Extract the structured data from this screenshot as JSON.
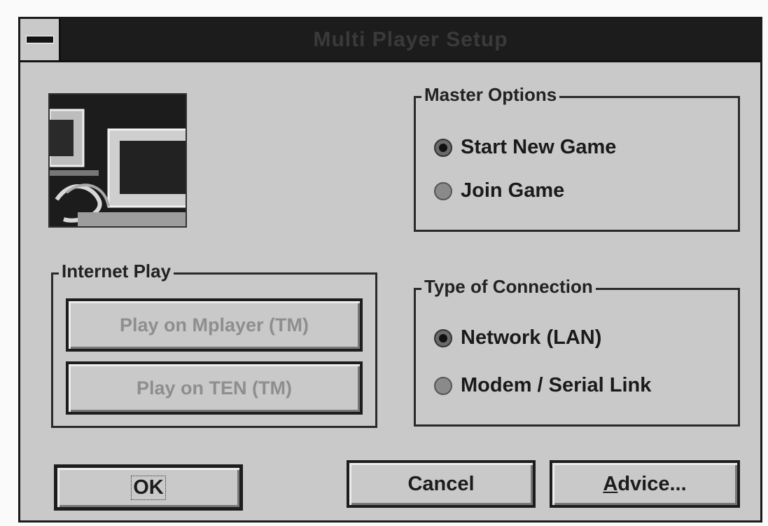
{
  "window": {
    "title": "Multi Player Setup"
  },
  "master_options": {
    "label": "Master Options",
    "options": [
      {
        "label": "Start New Game",
        "selected": true
      },
      {
        "label": "Join Game",
        "selected": false
      }
    ]
  },
  "internet_play": {
    "label": "Internet Play",
    "mplayer_label": "Play on Mplayer (TM)",
    "ten_label": "Play on TEN (TM)"
  },
  "connection": {
    "label": "Type of Connection",
    "options": [
      {
        "label": "Network (LAN)",
        "selected": true
      },
      {
        "label": "Modem / Serial Link",
        "selected": false
      }
    ]
  },
  "buttons": {
    "ok_label": "OK",
    "cancel_label": "Cancel",
    "advice_underlined": "A",
    "advice_rest": "dvice..."
  },
  "icons": {
    "system_menu": "system-menu-icon",
    "preview": "multiplayer-preview-image"
  }
}
